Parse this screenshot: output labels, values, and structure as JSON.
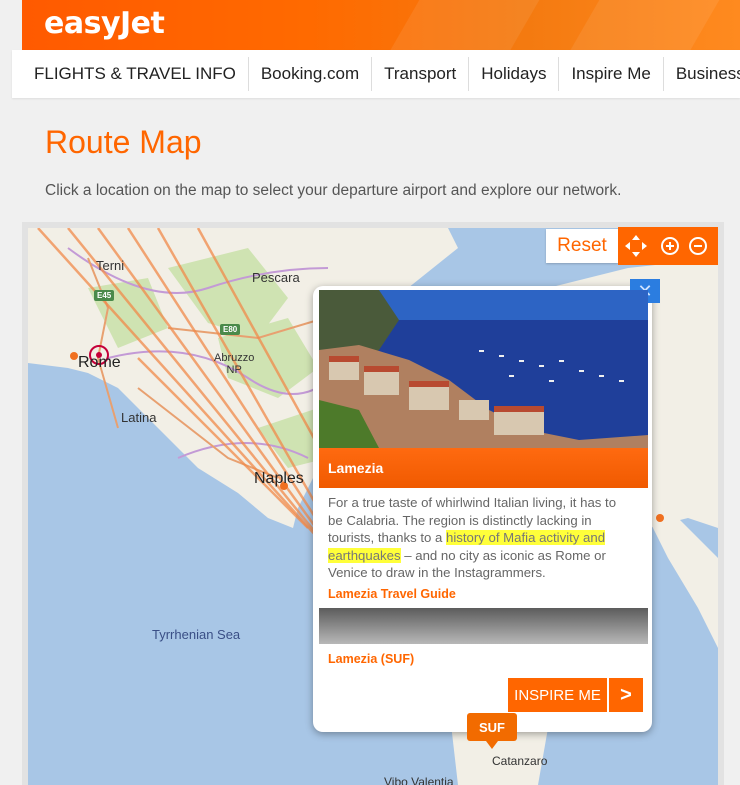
{
  "header": {
    "logo": "easyJet",
    "brand_color": "#ff6600"
  },
  "nav": {
    "items": [
      {
        "label": "FLIGHTS & TRAVEL INFO"
      },
      {
        "label": "Booking.com"
      },
      {
        "label": "Transport"
      },
      {
        "label": "Holidays"
      },
      {
        "label": "Inspire Me"
      },
      {
        "label": "Business"
      }
    ]
  },
  "page": {
    "title": "Route Map",
    "subtitle": "Click a location on the map to select your departure airport and explore our network."
  },
  "map": {
    "controls": {
      "reset_label": "Reset",
      "icons": [
        "pan-icon",
        "zoom-in-icon",
        "zoom-out-icon"
      ]
    },
    "labels": {
      "terni": "Terni",
      "pescara": "Pescara",
      "rome": "Rome",
      "abruzzo": "Abruzzo\nNP",
      "latina": "Latina",
      "naples": "Naples",
      "sea": "Tyrrhenian Sea",
      "catanzaro": "Catanzaro",
      "vibo": "Vibo Valentia"
    },
    "road_badges": {
      "e45": "E45",
      "e80": "E80"
    },
    "marker": {
      "code": "SUF"
    }
  },
  "popup": {
    "close": "✕",
    "title": "Lamezia",
    "text_before": "For a true taste of whirlwind Italian living, it has to be Calabria. The region is distinctly lacking in tourists, thanks to a ",
    "text_highlight": "history of Mafia activity and earthquakes",
    "text_after": " – and no city as iconic as Rome or Venice to draw in the Instagrammers.",
    "guide_link": "Lamezia Travel Guide",
    "airport_link": "Lamezia (SUF)",
    "inspire_label": "INSPIRE ME",
    "arrow_label": ">"
  }
}
